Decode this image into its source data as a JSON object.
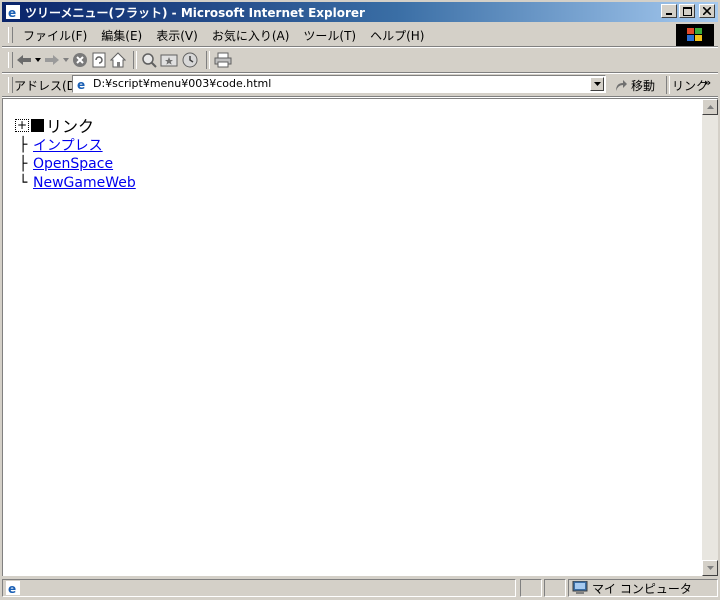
{
  "window": {
    "title": "ツリーメニュー(フラット) - Microsoft Internet Explorer"
  },
  "menu": {
    "items": [
      "ファイル(F)",
      "編集(E)",
      "表示(V)",
      "お気に入り(A)",
      "ツール(T)",
      "ヘルプ(H)"
    ]
  },
  "address": {
    "label": "アドレス(D)",
    "url": "D:¥script¥menu¥003¥code.html",
    "go_label": "移動",
    "links_label": "リンク"
  },
  "tree": {
    "toggle_symbol": "+",
    "root_label": "リンク",
    "children": [
      {
        "branch": "├",
        "label": "インプレス"
      },
      {
        "branch": "├",
        "label": "OpenSpace"
      },
      {
        "branch": "└",
        "label": "NewGameWeb"
      }
    ]
  },
  "status": {
    "zone_label": "マイ コンピュータ"
  },
  "colors": {
    "title_gradient_start": "#0a246a",
    "title_gradient_end": "#a6caf0",
    "chrome": "#d4d0c8",
    "link": "#0000ee"
  }
}
